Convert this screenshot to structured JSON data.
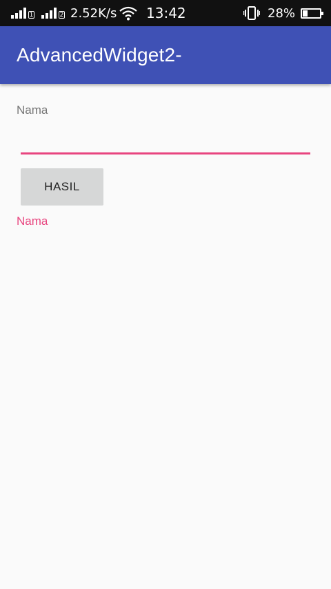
{
  "status_bar": {
    "sim1_label": "1",
    "sim2_label": "2",
    "network_speed": "2.52K/s",
    "time": "13:42",
    "battery_percent": "28%",
    "battery_level": 0.28,
    "icons": [
      "signal-icon",
      "wifi-icon",
      "vibrate-icon",
      "battery-icon"
    ]
  },
  "app_bar": {
    "title": "AdvancedWidget2-",
    "color": "#3f51b5"
  },
  "form": {
    "name_label": "Nama",
    "name_value": "",
    "button_label": "HASIL",
    "result_text": "Nama",
    "accent_color": "#e8457f"
  }
}
